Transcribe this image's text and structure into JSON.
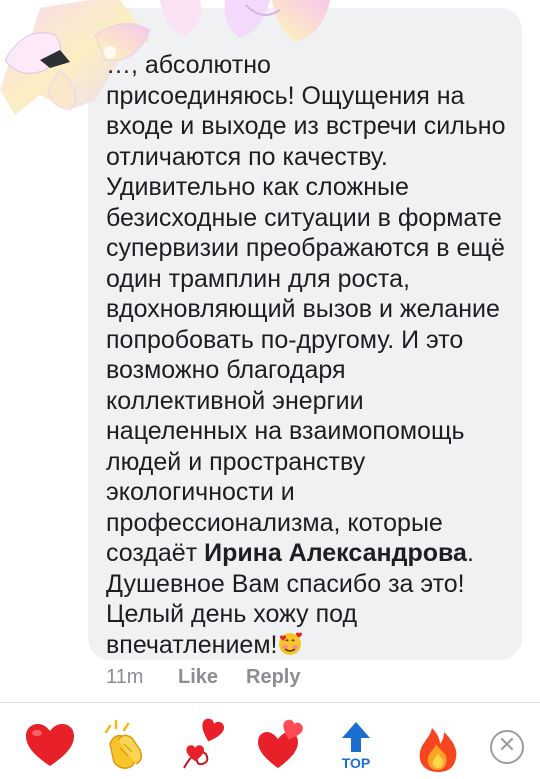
{
  "comment": {
    "line1": "…, абсолютно",
    "text_before_mention": "присоединяюсь! Ощущения на входе и  выходе из встречи сильно отличаются по качеству. Удивительно как сложные безисходные ситуации в формате супервизии преображаются в ещё один трамплин для роста, вдохновляющий вызов и желание попробовать по-другому. И это возможно благодаря коллективной энергии нацеленных на взаимопомощь людей и пространству экологичности и профессионализма, которые создаёт ",
    "mention": "Ирина Александрова",
    "text_after_mention": ". Душевное Вам спасибо за это! Целый день хожу под впечатлением!",
    "trailing_emoji": "smiling-face-with-hearts-icon"
  },
  "meta": {
    "time": "11m",
    "like": "Like",
    "reply": "Reply"
  },
  "reactions": [
    "red-heart-icon",
    "clapping-hands-icon",
    "heart-on-string-icon",
    "two-hearts-icon",
    "top-arrow-icon",
    "fire-icon",
    "close-icon"
  ],
  "top_arrow_label": "TOP",
  "colors": {
    "bubble": "#eff1f3",
    "text": "#1c1e21",
    "meta": "#8a8d91",
    "heart": "#e8202a",
    "top": "#1a6fd1"
  }
}
